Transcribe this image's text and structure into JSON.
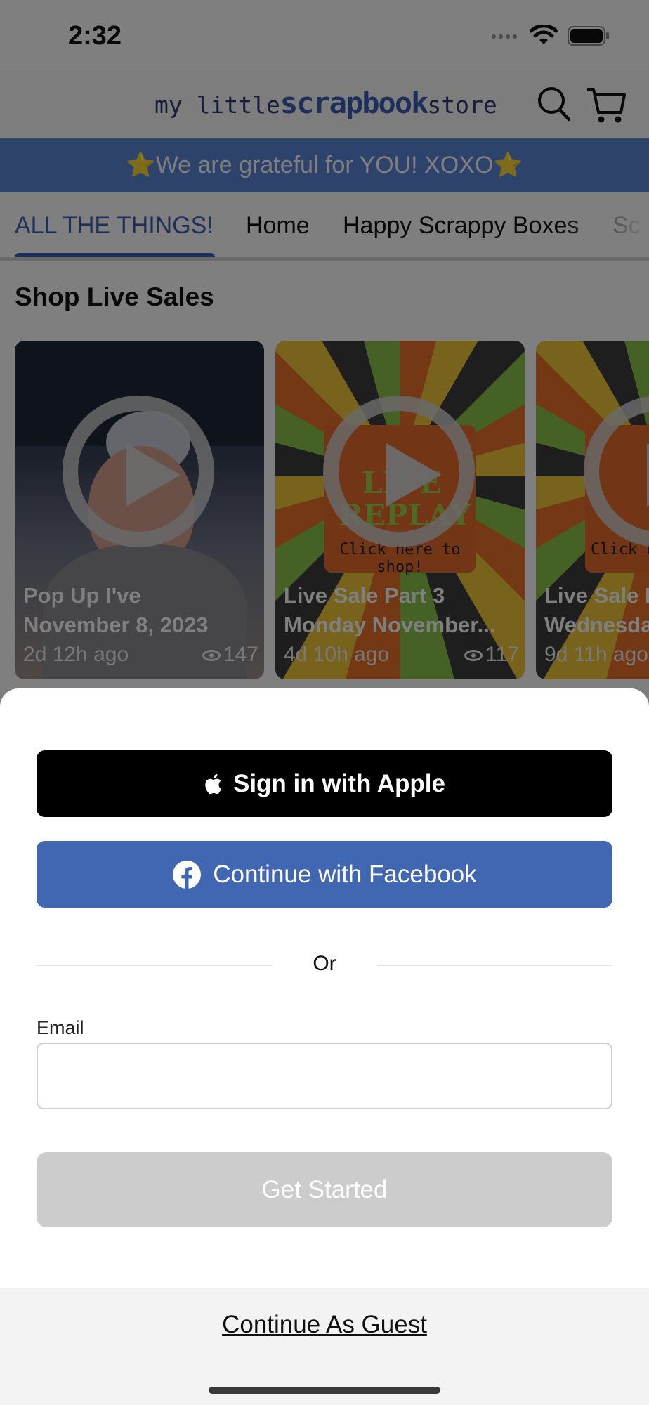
{
  "status_bar": {
    "time": "2:32"
  },
  "header": {
    "logo_small_1": "my little",
    "logo_big": "scrapbook",
    "logo_small_2": "store",
    "icons": [
      "search-icon",
      "cart-icon"
    ]
  },
  "banner": {
    "text": "⭐We are grateful for YOU!  XOXO⭐"
  },
  "tabs": [
    {
      "label": "ALL THE THINGS!",
      "active": true
    },
    {
      "label": "Home"
    },
    {
      "label": "Happy Scrappy Boxes"
    },
    {
      "label": "Sc"
    }
  ],
  "live_sales": {
    "title": "Shop Live Sales",
    "cards": [
      {
        "line1": "Pop Up I've",
        "line2": "November 8, 2023",
        "age": "2d 12h ago",
        "views": "147"
      },
      {
        "line1": "Live Sale Part 3",
        "line2": "Monday November...",
        "age": "4d 10h ago",
        "views": "117",
        "thumb_text_1": "LIVE",
        "thumb_text_2": "REPLAY",
        "thumb_text_3": "Click here to shop!"
      },
      {
        "line1": "Live Sale P",
        "line2": "Wednesda",
        "age": "9d 11h ago",
        "views": "",
        "thumb_text_3": "Click he"
      }
    ]
  },
  "sheet": {
    "apple_button": "Sign in with Apple",
    "facebook_button": "Continue with Facebook",
    "or_text": "Or",
    "email_label": "Email",
    "email_value": "",
    "email_placeholder": "",
    "get_started_button": "Get Started",
    "guest_link": "Continue As Guest"
  },
  "colors": {
    "brand_blue": "#3d60b5",
    "banner_blue": "#5a86d8",
    "facebook_blue": "#4267b2",
    "disabled_gray": "#cccccc"
  }
}
